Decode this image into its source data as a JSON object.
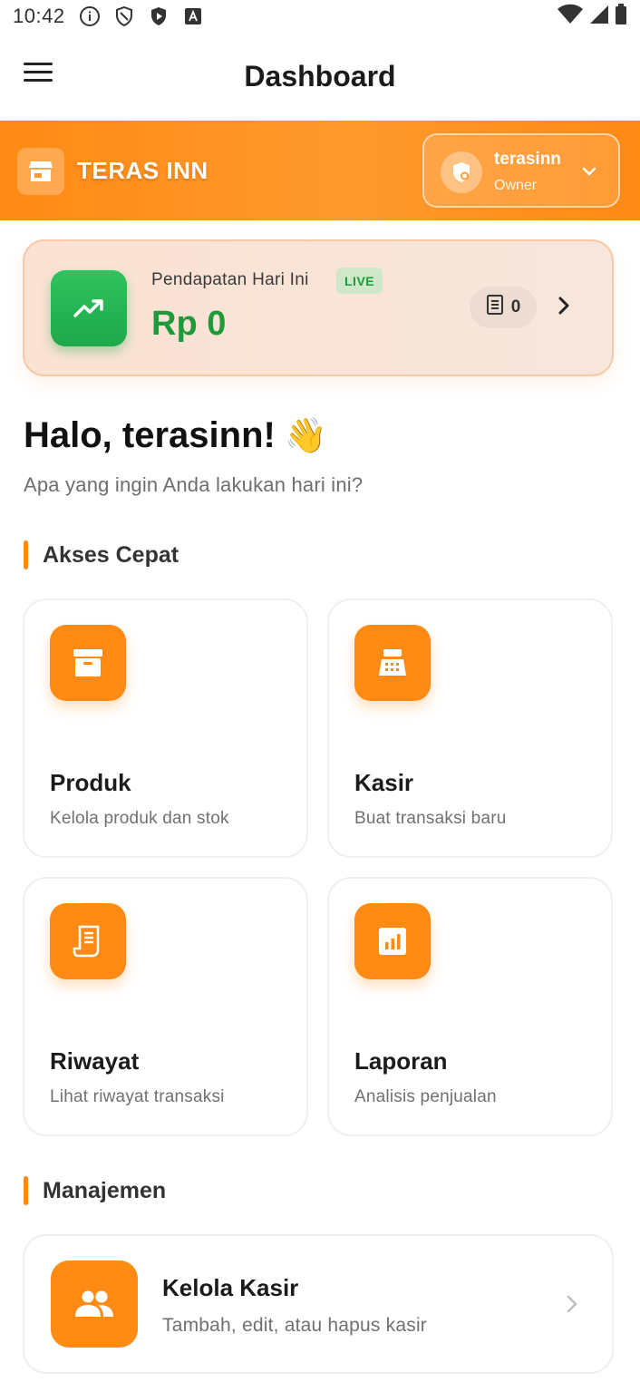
{
  "status_bar": {
    "time": "10:42",
    "left_icons": [
      "info-icon",
      "shield-icon",
      "play-protect-icon",
      "font-icon"
    ],
    "right_icons": [
      "wifi-icon",
      "cell-signal-icon",
      "battery-icon"
    ]
  },
  "app_bar": {
    "title": "Dashboard",
    "menu_icon": "hamburger-menu-icon"
  },
  "store": {
    "name": "TERAS INN",
    "icon": "store-icon",
    "user": {
      "name": "terasinn",
      "role": "Owner",
      "icon": "admin-shield-icon",
      "dropdown_icon": "chevron-down-icon"
    }
  },
  "revenue": {
    "label": "Pendapatan Hari Ini",
    "badge": "LIVE",
    "value": "Rp 0",
    "transactions": "0",
    "icon": "trending-up-icon"
  },
  "greeting": {
    "title": "Halo, terasinn!",
    "emoji": "👋",
    "subtitle": "Apa yang ingin Anda lakukan hari ini?"
  },
  "quick_access": {
    "title": "Akses Cepat",
    "items": [
      {
        "name": "Produk",
        "desc": "Kelola produk dan stok",
        "icon": "archive-box-icon"
      },
      {
        "name": "Kasir",
        "desc": "Buat transaksi baru",
        "icon": "cash-register-icon"
      },
      {
        "name": "Riwayat",
        "desc": "Lihat riwayat transaksi",
        "icon": "receipt-icon"
      },
      {
        "name": "Laporan",
        "desc": "Analisis penjualan",
        "icon": "bar-chart-icon"
      }
    ]
  },
  "management": {
    "title": "Manajemen",
    "items": [
      {
        "name": "Kelola Kasir",
        "desc": "Tambah, edit, atau hapus kasir",
        "icon": "people-icon"
      }
    ]
  },
  "colors": {
    "accent": "#ff8a14",
    "success": "#1e9a3b",
    "live_badge_bg": "#cfe8c9"
  }
}
